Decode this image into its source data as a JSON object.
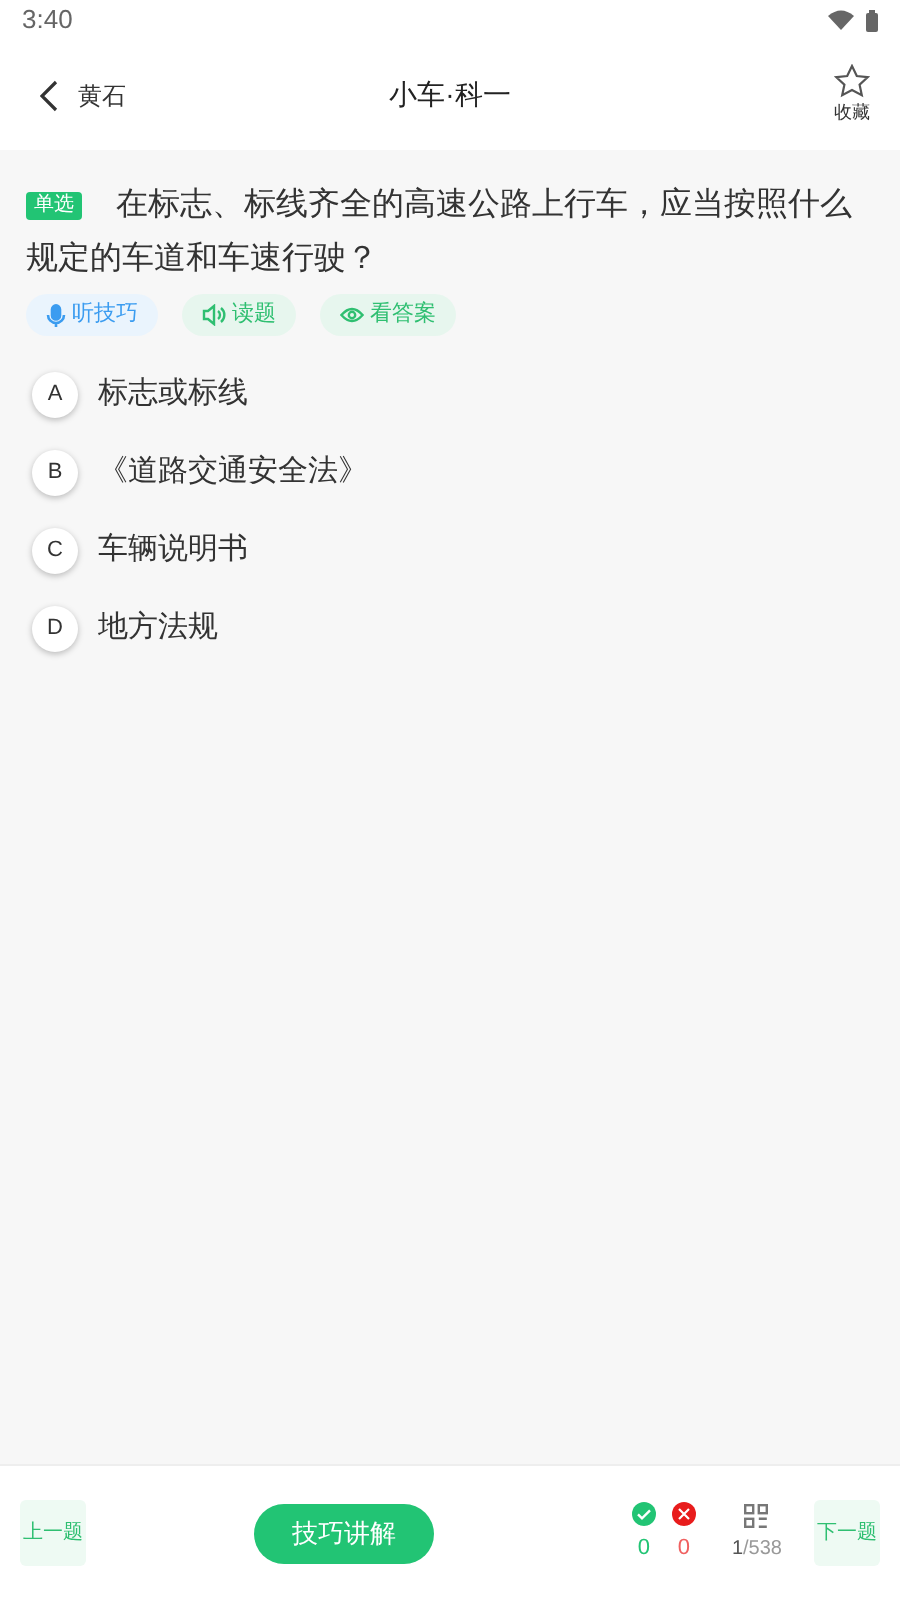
{
  "status_bar": {
    "time": "3:40"
  },
  "header": {
    "back_label": "黄石",
    "title": "小车·科一",
    "favorite_label": "收藏"
  },
  "question": {
    "type_badge": "单选",
    "text": "在标志、标线齐全的高速公路上行车，应当按照什么规定的车道和车速行驶？",
    "tools": [
      {
        "kind": "listen",
        "label": "听技巧"
      },
      {
        "kind": "read",
        "label": "读题"
      },
      {
        "kind": "answer",
        "label": "看答案"
      }
    ],
    "options": [
      {
        "letter": "A",
        "text": "标志或标线",
        "selected": false
      },
      {
        "letter": "B",
        "text": "《道路交通安全法》",
        "selected": false
      },
      {
        "letter": "C",
        "text": "车辆说明书",
        "selected": false
      },
      {
        "letter": "D",
        "text": "地方法规",
        "selected": false
      }
    ]
  },
  "bottom_bar": {
    "prev_label": "上一题",
    "explain_label": "技巧讲解",
    "correct_count": "0",
    "wrong_count": "0",
    "current": "1",
    "total": "/538",
    "next_label": "下一题"
  }
}
